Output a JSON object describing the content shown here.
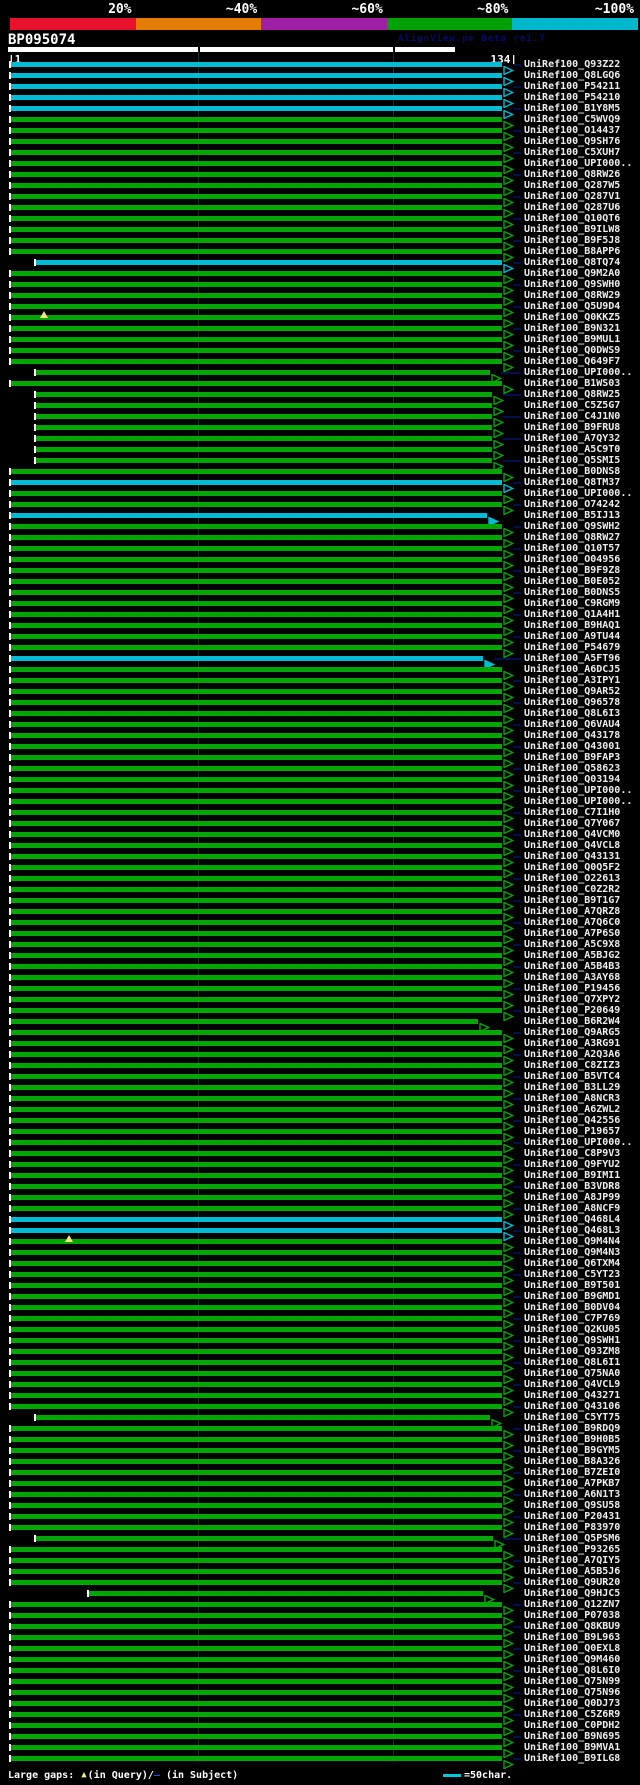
{
  "header": {
    "identity_scale": [
      {
        "label": "20%",
        "color": "#e8112d"
      },
      {
        "label": "~40%",
        "color": "#e57c00"
      },
      {
        "label": "~60%",
        "color": "#9e1fa5"
      },
      {
        "label": "~80%",
        "color": "#00a000"
      },
      {
        "label": "~100%",
        "color": "#00b7cd"
      }
    ],
    "query_id": "BP095074",
    "watermark": "AlignView.pm Beta re1.7",
    "ruler_start": "|1",
    "ruler_end": "134|"
  },
  "footer": {
    "large_gaps_label": "Large gaps: ",
    "query_gap_symbol": "▲",
    "query_gap_caption": "(in Query)/",
    "subject_gap_symbol": "–",
    "subject_gap_caption": " (in Subject)",
    "ruler_sample_caption": "=50char.",
    "colors": {
      "query_gap": "#f0e87a",
      "subject_gap": "#2b50d8",
      "sample_line": "#00c8dc"
    }
  },
  "bar_colors": {
    "green": "#00a600",
    "cyan": "#00bcd2"
  },
  "row_defaults": {
    "color": "green",
    "start": 10,
    "end": 502,
    "arrow": "hollow"
  },
  "rows": [
    {
      "label": "UniRef100_Q93Z22",
      "color": "cyan"
    },
    {
      "label": "UniRef100_Q8LGQ6",
      "color": "cyan"
    },
    {
      "label": "UniRef100_P54211",
      "color": "cyan"
    },
    {
      "label": "UniRef100_P54210",
      "color": "cyan"
    },
    {
      "label": "UniRef100_B1Y8M5",
      "color": "cyan"
    },
    {
      "label": "UniRef100_C5WVQ9"
    },
    {
      "label": "UniRef100_O14437"
    },
    {
      "label": "UniRef100_Q9SH76"
    },
    {
      "label": "UniRef100_C5XUH7"
    },
    {
      "label": "UniRef100_UPI000.."
    },
    {
      "label": "UniRef100_Q8RW26"
    },
    {
      "label": "UniRef100_Q287W5"
    },
    {
      "label": "UniRef100_Q287V1"
    },
    {
      "label": "UniRef100_Q287U6"
    },
    {
      "label": "UniRef100_Q10QT6"
    },
    {
      "label": "UniRef100_B9ILW8"
    },
    {
      "label": "UniRef100_B9F5J8"
    },
    {
      "label": "UniRef100_B8APP6"
    },
    {
      "label": "UniRef100_Q8TQ74",
      "color": "cyan",
      "start": 35
    },
    {
      "label": "UniRef100_Q9M2A0"
    },
    {
      "label": "UniRef100_Q9SWH0"
    },
    {
      "label": "UniRef100_Q8RW29"
    },
    {
      "label": "UniRef100_Q5U9D4"
    },
    {
      "label": "UniRef100_Q0KKZ5",
      "marker": 40
    },
    {
      "label": "UniRef100_B9N321"
    },
    {
      "label": "UniRef100_B9MUL1"
    },
    {
      "label": "UniRef100_Q0DWS9"
    },
    {
      "label": "UniRef100_Q649F7"
    },
    {
      "label": "UniRef100_UPI000..",
      "start": 35,
      "end": 490
    },
    {
      "label": "UniRef100_B1WS03"
    },
    {
      "label": "UniRef100_Q8RW25",
      "start": 35,
      "end": 492
    },
    {
      "label": "UniRef100_C5Z5G7",
      "start": 35,
      "end": 492
    },
    {
      "label": "UniRef100_C4J1N0",
      "start": 35,
      "end": 492
    },
    {
      "label": "UniRef100_B9FRU8",
      "start": 35,
      "end": 492
    },
    {
      "label": "UniRef100_A7QY32",
      "start": 35,
      "end": 492
    },
    {
      "label": "UniRef100_A5C9T0",
      "start": 35,
      "end": 492
    },
    {
      "label": "UniRef100_Q5SMI5",
      "start": 35,
      "end": 492
    },
    {
      "label": "UniRef100_B0DNS8"
    },
    {
      "label": "UniRef100_Q8TM37",
      "color": "cyan"
    },
    {
      "label": "UniRef100_UPI000.."
    },
    {
      "label": "UniRef100_O74242"
    },
    {
      "label": "UniRef100_B5IJ13",
      "color": "cyan",
      "end": 487,
      "arrow": "filled"
    },
    {
      "label": "UniRef100_Q9SWH2"
    },
    {
      "label": "UniRef100_Q8RW27"
    },
    {
      "label": "UniRef100_Q10T57"
    },
    {
      "label": "UniRef100_O04956"
    },
    {
      "label": "UniRef100_B9F9Z8"
    },
    {
      "label": "UniRef100_B0E052"
    },
    {
      "label": "UniRef100_B0DNS5"
    },
    {
      "label": "UniRef100_C9RGM9"
    },
    {
      "label": "UniRef100_Q1A4H1"
    },
    {
      "label": "UniRef100_B9HAQ1"
    },
    {
      "label": "UniRef100_A9TU44"
    },
    {
      "label": "UniRef100_P54679"
    },
    {
      "label": "UniRef100_A5FT96",
      "color": "cyan",
      "end": 483,
      "arrow": "filled"
    },
    {
      "label": "UniRef100_A6DCJ5"
    },
    {
      "label": "UniRef100_A3IPY1"
    },
    {
      "label": "UniRef100_Q9AR52"
    },
    {
      "label": "UniRef100_Q96578"
    },
    {
      "label": "UniRef100_Q8L6I3"
    },
    {
      "label": "UniRef100_Q6VAU4"
    },
    {
      "label": "UniRef100_Q43178"
    },
    {
      "label": "UniRef100_Q43001"
    },
    {
      "label": "UniRef100_B9FAP3"
    },
    {
      "label": "UniRef100_Q58623"
    },
    {
      "label": "UniRef100_Q03194"
    },
    {
      "label": "UniRef100_UPI000.."
    },
    {
      "label": "UniRef100_UPI000.."
    },
    {
      "label": "UniRef100_C7I1H0"
    },
    {
      "label": "UniRef100_Q7Y067"
    },
    {
      "label": "UniRef100_Q4VCM0"
    },
    {
      "label": "UniRef100_Q4VCL8"
    },
    {
      "label": "UniRef100_Q43131"
    },
    {
      "label": "UniRef100_Q0Q5F2"
    },
    {
      "label": "UniRef100_O22613"
    },
    {
      "label": "UniRef100_C0Z2R2"
    },
    {
      "label": "UniRef100_B9T1G7"
    },
    {
      "label": "UniRef100_A7QRZ8"
    },
    {
      "label": "UniRef100_A7Q6C0"
    },
    {
      "label": "UniRef100_A7P6S0"
    },
    {
      "label": "UniRef100_A5C9X8"
    },
    {
      "label": "UniRef100_A5BJG2"
    },
    {
      "label": "UniRef100_A5B4B3"
    },
    {
      "label": "UniRef100_A3AY68"
    },
    {
      "label": "UniRef100_P19456"
    },
    {
      "label": "UniRef100_Q7XPY2"
    },
    {
      "label": "UniRef100_P20649"
    },
    {
      "label": "UniRef100_B6R2W4",
      "end": 478
    },
    {
      "label": "UniRef100_Q9ARG5"
    },
    {
      "label": "UniRef100_A3RG91"
    },
    {
      "label": "UniRef100_A2Q3A6"
    },
    {
      "label": "UniRef100_C8ZIZ3"
    },
    {
      "label": "UniRef100_B5VTC4"
    },
    {
      "label": "UniRef100_B3LL29"
    },
    {
      "label": "UniRef100_A8NCR3"
    },
    {
      "label": "UniRef100_A6ZWL2"
    },
    {
      "label": "UniRef100_Q42556"
    },
    {
      "label": "UniRef100_P19657"
    },
    {
      "label": "UniRef100_UPI000.."
    },
    {
      "label": "UniRef100_C8P9V3"
    },
    {
      "label": "UniRef100_Q9FYU2"
    },
    {
      "label": "UniRef100_B9IMI1"
    },
    {
      "label": "UniRef100_B3VDR8"
    },
    {
      "label": "UniRef100_A8JP99"
    },
    {
      "label": "UniRef100_A8NCF9"
    },
    {
      "label": "UniRef100_Q468L4",
      "color": "cyan"
    },
    {
      "label": "UniRef100_Q468L3",
      "color": "cyan"
    },
    {
      "label": "UniRef100_Q9M4N4",
      "marker": 65
    },
    {
      "label": "UniRef100_Q9M4N3"
    },
    {
      "label": "UniRef100_Q6TXM4"
    },
    {
      "label": "UniRef100_C5YT23"
    },
    {
      "label": "UniRef100_B9T501"
    },
    {
      "label": "UniRef100_B9GMD1"
    },
    {
      "label": "UniRef100_B0DV04"
    },
    {
      "label": "UniRef100_C7P769"
    },
    {
      "label": "UniRef100_Q2KU05"
    },
    {
      "label": "UniRef100_Q9SWH1"
    },
    {
      "label": "UniRef100_Q93ZM8"
    },
    {
      "label": "UniRef100_Q8L6I1"
    },
    {
      "label": "UniRef100_Q75NA0"
    },
    {
      "label": "UniRef100_Q4VCL9"
    },
    {
      "label": "UniRef100_Q43271"
    },
    {
      "label": "UniRef100_Q43106"
    },
    {
      "label": "UniRef100_C5YT75",
      "start": 35,
      "end": 490
    },
    {
      "label": "UniRef100_B9RDQ9"
    },
    {
      "label": "UniRef100_B9H0B5"
    },
    {
      "label": "UniRef100_B9GYM5"
    },
    {
      "label": "UniRef100_B8A326"
    },
    {
      "label": "UniRef100_B7ZEI0"
    },
    {
      "label": "UniRef100_A7PKB7"
    },
    {
      "label": "UniRef100_A6N1T3"
    },
    {
      "label": "UniRef100_Q9SU58"
    },
    {
      "label": "UniRef100_P20431"
    },
    {
      "label": "UniRef100_P83970"
    },
    {
      "label": "UniRef100_Q5PSM6",
      "start": 35,
      "end": 493
    },
    {
      "label": "UniRef100_P93265"
    },
    {
      "label": "UniRef100_A7QIY5"
    },
    {
      "label": "UniRef100_A5B5J6"
    },
    {
      "label": "UniRef100_Q9UR20"
    },
    {
      "label": "UniRef100_Q9HJC5",
      "start": 88,
      "end": 483
    },
    {
      "label": "UniRef100_Q12ZN7"
    },
    {
      "label": "UniRef100_P07038"
    },
    {
      "label": "UniRef100_Q8KBU9"
    },
    {
      "label": "UniRef100_B9L963"
    },
    {
      "label": "UniRef100_Q0EXL8"
    },
    {
      "label": "UniRef100_Q9M460"
    },
    {
      "label": "UniRef100_Q8L6I0"
    },
    {
      "label": "UniRef100_Q75N99"
    },
    {
      "label": "UniRef100_Q75N96"
    },
    {
      "label": "UniRef100_Q0DJ73"
    },
    {
      "label": "UniRef100_C5Z6R9"
    },
    {
      "label": "UniRef100_C0PDH2"
    },
    {
      "label": "UniRef100_B9N695"
    },
    {
      "label": "UniRef100_B9MVA1"
    },
    {
      "label": "UniRef100_B9ILG8"
    }
  ]
}
